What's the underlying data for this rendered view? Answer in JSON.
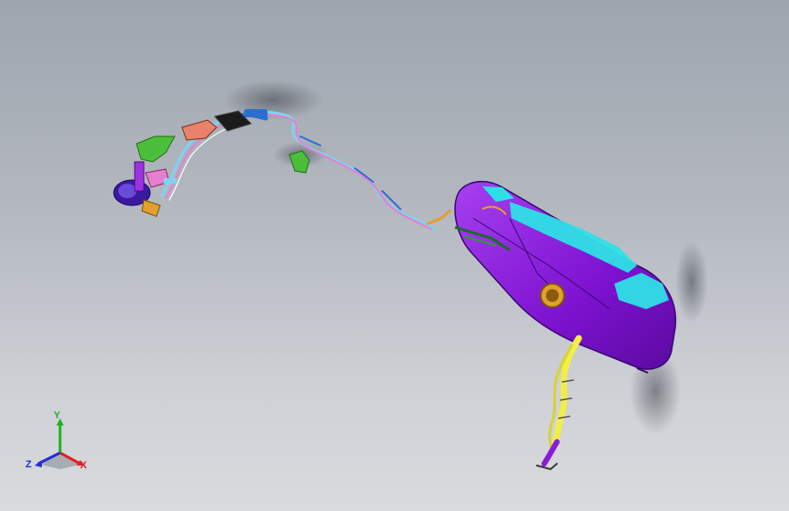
{
  "viewport": {
    "background_top": "#9ea5ae",
    "background_bottom": "#d9dbde"
  },
  "model": {
    "parts": [
      "fuel-tank",
      "fuel-pump-module",
      "filler-neck",
      "fuel-line",
      "evap-canister",
      "mounting-bracket"
    ],
    "colors": {
      "tank": "#8a1bd8",
      "tank_highlight": "#2de0e6",
      "filler_neck": "#f1ee4a",
      "lines_blue": "#7fd3f0",
      "lines_pink": "#e67fcf",
      "bracket_green": "#4bbf3a",
      "pump_orange": "#e0a02a"
    }
  },
  "triad": {
    "x_label": "X",
    "y_label": "Y",
    "z_label": "Z",
    "x_color": "#e02020",
    "y_color": "#20b020",
    "z_color": "#2030d0"
  }
}
